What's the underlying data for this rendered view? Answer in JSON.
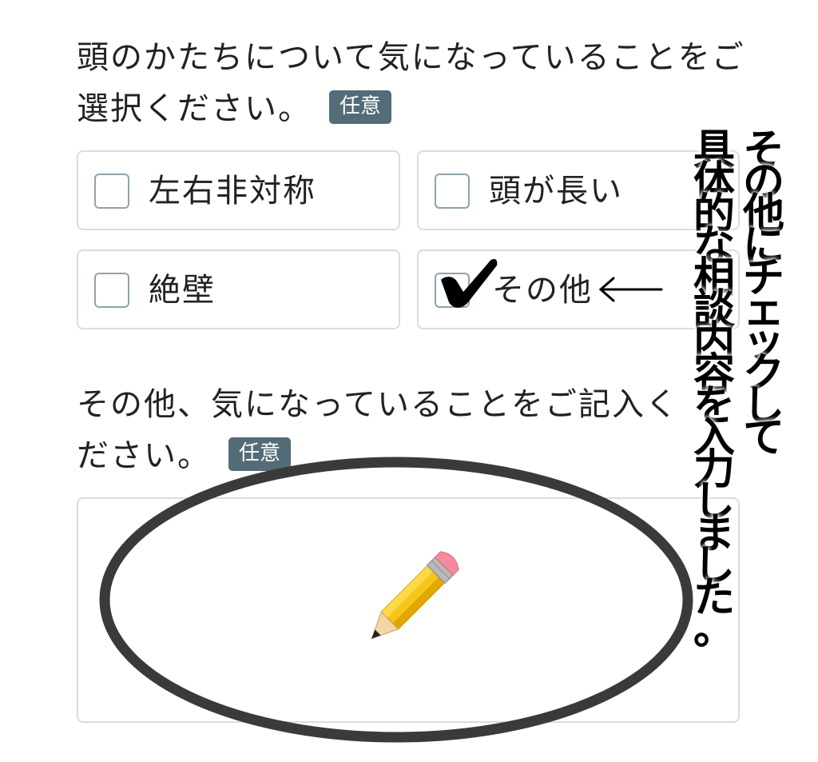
{
  "question1": {
    "text": "頭のかたちについて気になっていることをご選択ください。",
    "badge": "任意"
  },
  "options": [
    {
      "label": "左右非対称",
      "checked": false
    },
    {
      "label": "頭が長い",
      "checked": false
    },
    {
      "label": "絶壁",
      "checked": false
    },
    {
      "label": "その他",
      "checked": true
    }
  ],
  "question2": {
    "text": "その他、気になっていることをご記入ください。",
    "badge": "任意"
  },
  "annotations": {
    "note_line1": "その他にチェックして",
    "note_line2": "具体的な相談内容を入力しました。",
    "arrow": "⟵",
    "check_mark": "✔",
    "pencil_icon": "pencil-icon"
  },
  "colors": {
    "badge_bg": "#546b78",
    "checkbox_border": "#8fa3ad",
    "box_border": "#dcdcdc",
    "pencil_body": "#f5c518",
    "circle_stroke": "#3a3a3a"
  }
}
